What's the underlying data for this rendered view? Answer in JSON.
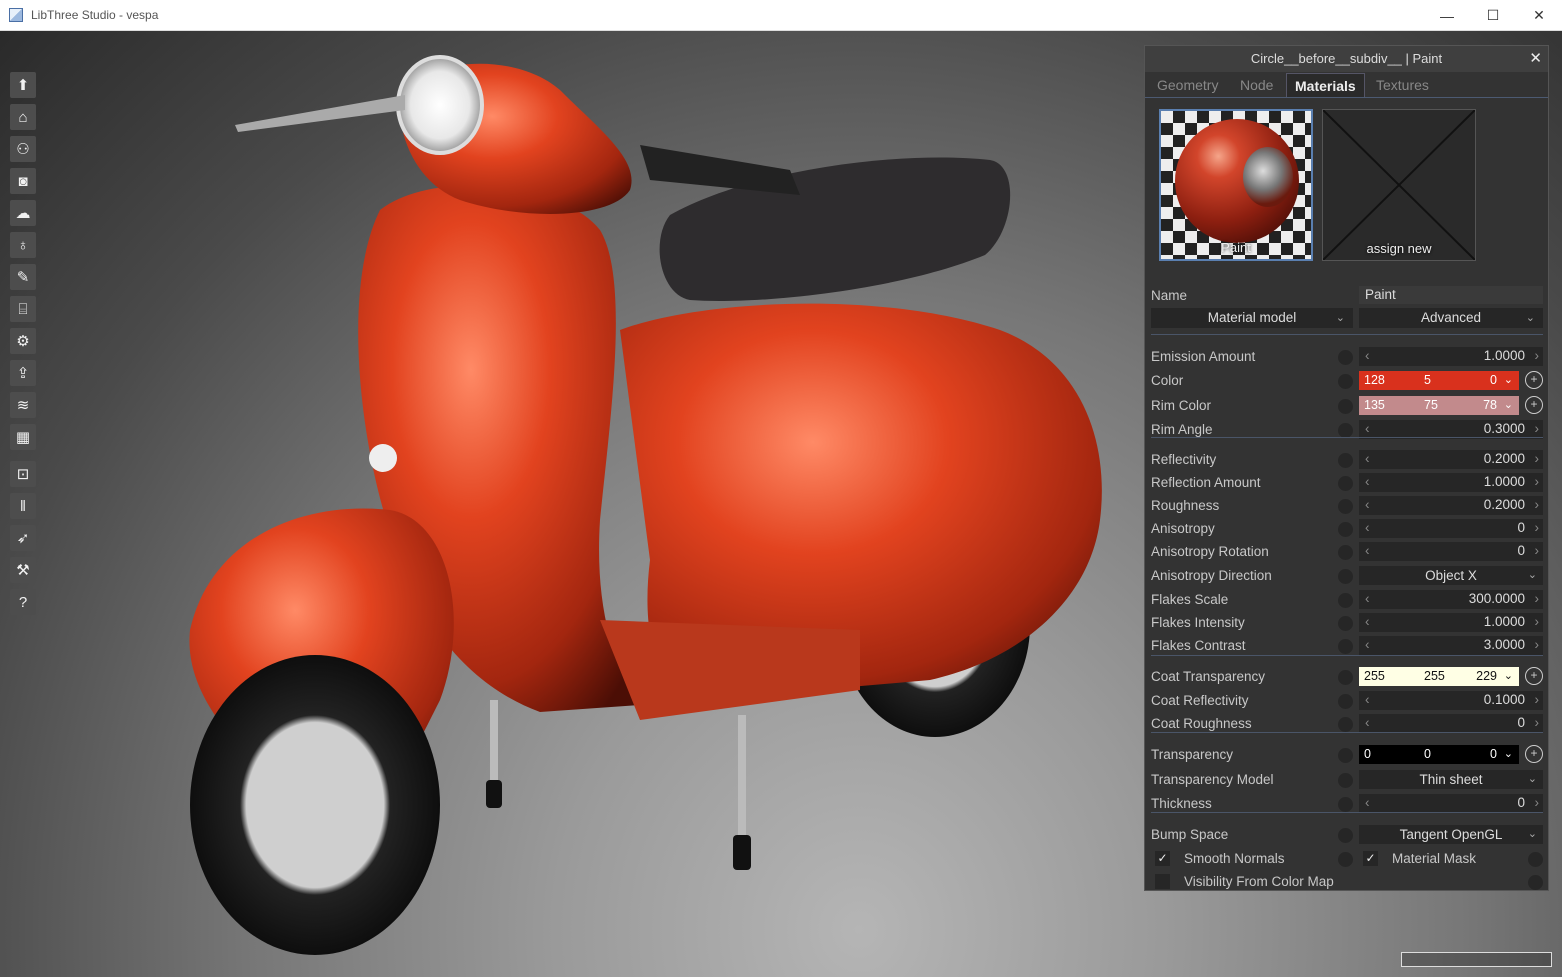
{
  "window": {
    "title": "LibThree Studio - vespa",
    "minimize": "—",
    "maximize": "☐",
    "close": "✕"
  },
  "toolbar": {
    "items": [
      {
        "icon": "up-arrow-icon",
        "glyph": "⬆"
      },
      {
        "icon": "home-icon",
        "glyph": "⌂"
      },
      {
        "icon": "hierarchy-icon",
        "glyph": "⚇"
      },
      {
        "icon": "camera-icon",
        "glyph": "◙"
      },
      {
        "icon": "cloud-icon",
        "glyph": "☁"
      },
      {
        "icon": "lightbulb-icon",
        "glyph": "♁"
      },
      {
        "icon": "brush-icon",
        "glyph": "✎"
      },
      {
        "icon": "environment-icon",
        "glyph": "⌸"
      },
      {
        "icon": "settings-gear-icon",
        "glyph": "⚙"
      },
      {
        "icon": "export-icon",
        "glyph": "⇪"
      },
      {
        "icon": "layers-icon",
        "glyph": "≋"
      },
      {
        "icon": "grid-icon",
        "glyph": "▦"
      },
      {
        "icon": "lock-icon",
        "glyph": "⊡"
      },
      {
        "icon": "pause-icon",
        "glyph": "‖"
      },
      {
        "icon": "rocket-icon",
        "glyph": "➶"
      },
      {
        "icon": "tools-icon",
        "glyph": "⚒"
      },
      {
        "icon": "help-icon",
        "glyph": "?"
      }
    ]
  },
  "panel": {
    "title": "Circle__before__subdiv__ | Paint",
    "close": "✕",
    "tabs": [
      "Geometry",
      "Node",
      "Materials",
      "Textures"
    ],
    "active_tab": "Materials",
    "swatch_paint_label": "Paint",
    "swatch_new_label": "assign new",
    "name_label": "Name",
    "name_value": "Paint",
    "material_model": "Material model",
    "material_mode": "Advanced",
    "emission_amount": {
      "label": "Emission Amount",
      "value": "1.0000"
    },
    "color": {
      "label": "Color",
      "r": "128",
      "g": "5",
      "b": "0",
      "bg": "#d9311d"
    },
    "rim_color": {
      "label": "Rim Color",
      "r": "135",
      "g": "75",
      "b": "78",
      "bg": "#c28a8c"
    },
    "rim_angle": {
      "label": "Rim Angle",
      "value": "0.3000"
    },
    "reflectivity": {
      "label": "Reflectivity",
      "value": "0.2000"
    },
    "reflection_amount": {
      "label": "Reflection Amount",
      "value": "1.0000"
    },
    "roughness": {
      "label": "Roughness",
      "value": "0.2000"
    },
    "anisotropy": {
      "label": "Anisotropy",
      "value": "0"
    },
    "anisotropy_rotation": {
      "label": "Anisotropy Rotation",
      "value": "0"
    },
    "anisotropy_direction": {
      "label": "Anisotropy Direction",
      "value": "Object X"
    },
    "flakes_scale": {
      "label": "Flakes Scale",
      "value": "300.0000"
    },
    "flakes_intensity": {
      "label": "Flakes Intensity",
      "value": "1.0000"
    },
    "flakes_contrast": {
      "label": "Flakes Contrast",
      "value": "3.0000"
    },
    "coat_transparency": {
      "label": "Coat Transparency",
      "r": "255",
      "g": "255",
      "b": "229",
      "bg": "#ffffe5"
    },
    "coat_reflectivity": {
      "label": "Coat Reflectivity",
      "value": "0.1000"
    },
    "coat_roughness": {
      "label": "Coat Roughness",
      "value": "0"
    },
    "transparency": {
      "label": "Transparency",
      "r": "0",
      "g": "0",
      "b": "0",
      "bg": "#000000"
    },
    "transparency_model": {
      "label": "Transparency Model",
      "value": "Thin sheet"
    },
    "thickness": {
      "label": "Thickness",
      "value": "0"
    },
    "bump_space": {
      "label": "Bump Space",
      "value": "Tangent OpenGL"
    },
    "smooth_normals": {
      "label": "Smooth Normals",
      "checked": "✓"
    },
    "material_mask": {
      "label": "Material Mask",
      "checked": "✓"
    },
    "visibility_from_color_map": {
      "label": "Visibility From Color Map",
      "checked": ""
    }
  }
}
